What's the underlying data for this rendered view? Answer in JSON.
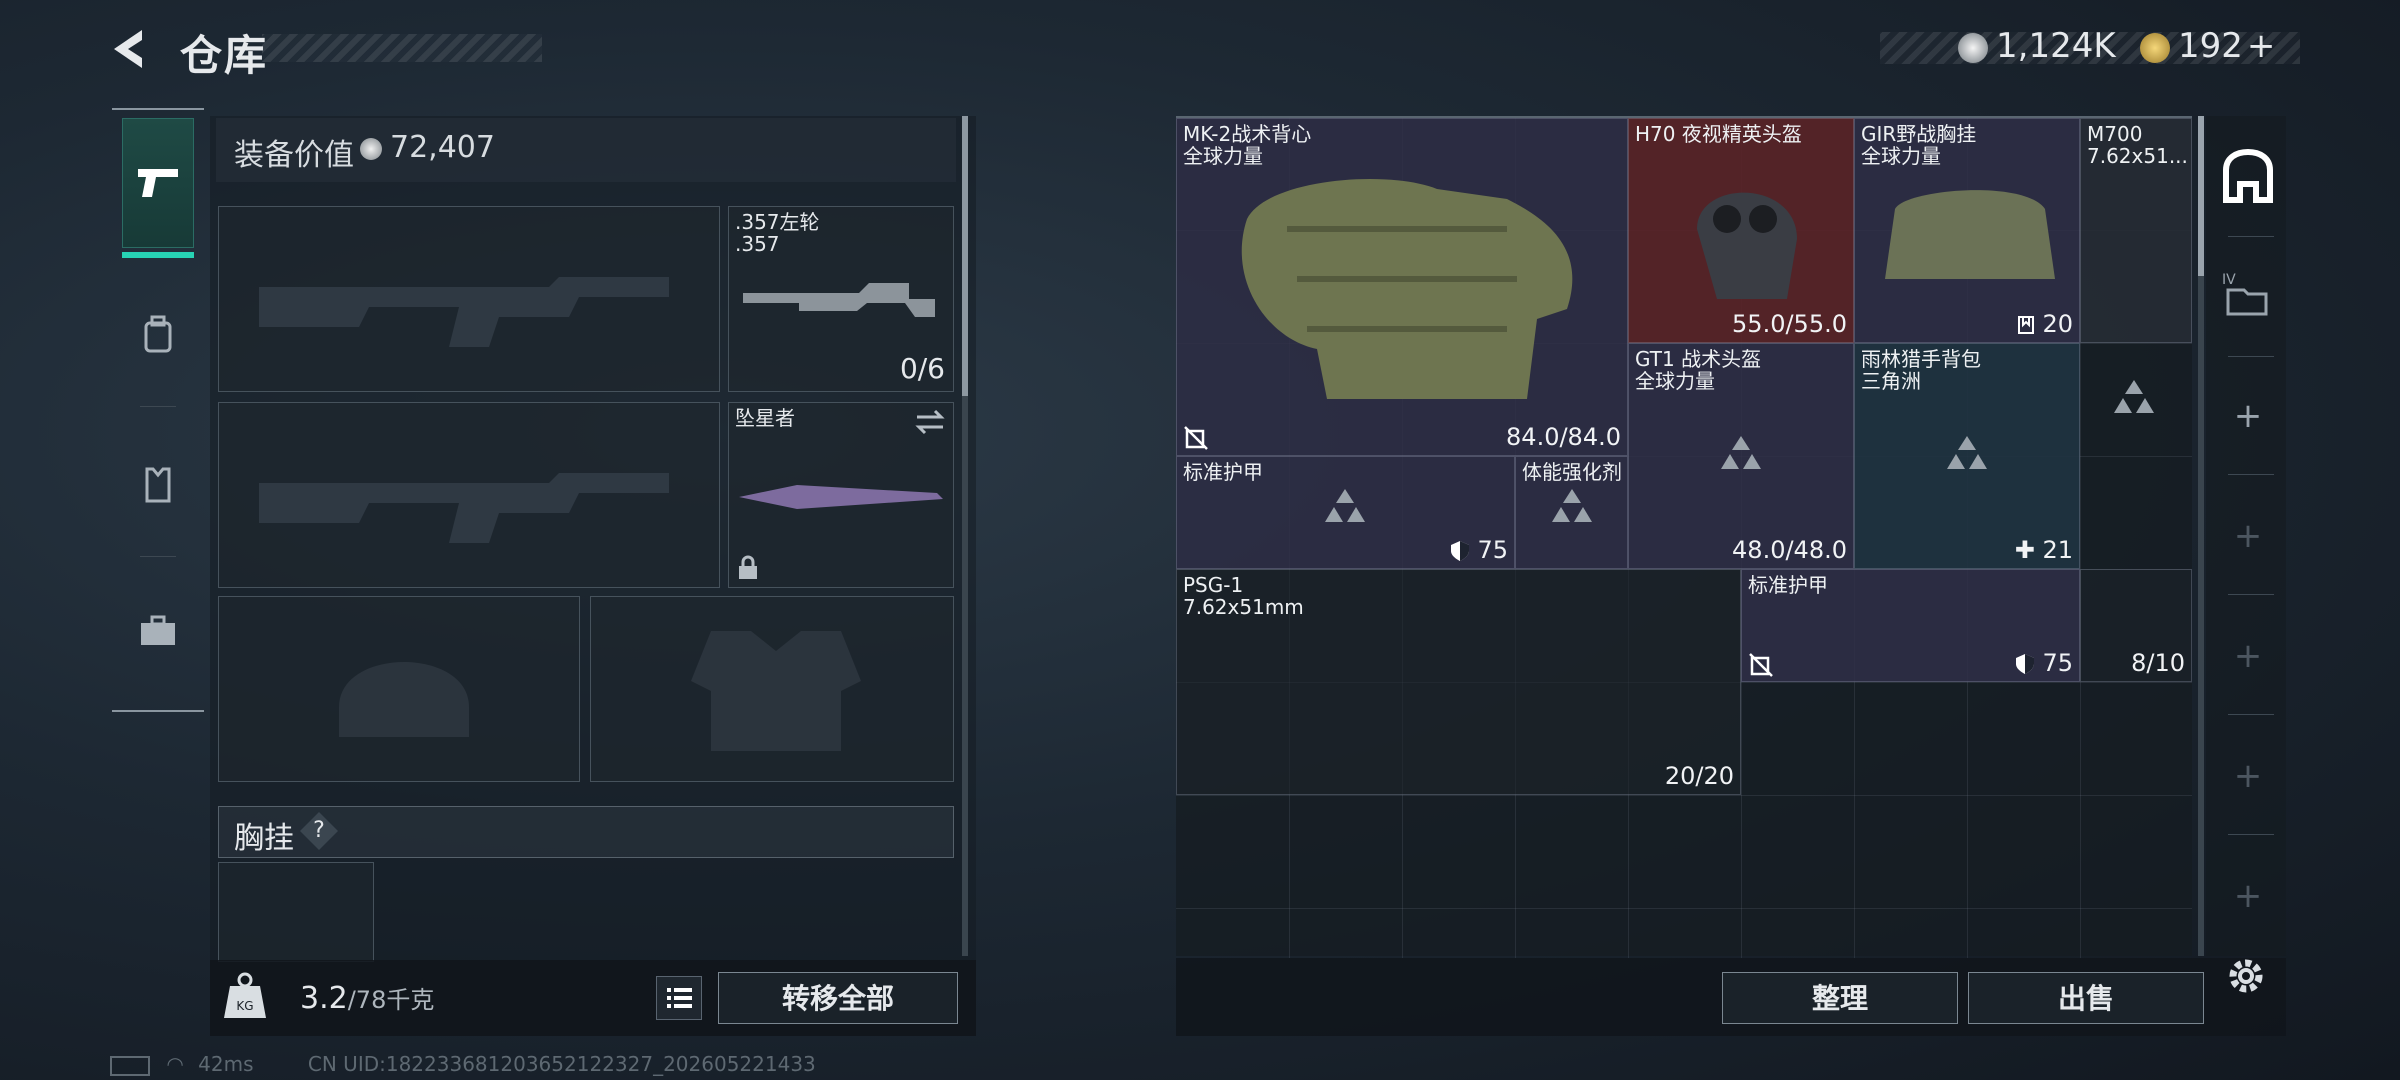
{
  "header": {
    "title": "仓库",
    "back_icon": "back-arrow-icon"
  },
  "currency": {
    "silver": "1,124K",
    "gold": "192",
    "gold_add": "+"
  },
  "left_rail": {
    "tabs": [
      {
        "name": "weapon",
        "icon": "pistol-icon",
        "active": true
      },
      {
        "name": "gear",
        "icon": "backpack-icon",
        "active": false
      },
      {
        "name": "vest",
        "icon": "vest-icon",
        "active": false
      },
      {
        "name": "case",
        "icon": "toolbox-icon",
        "active": false
      }
    ]
  },
  "equipment": {
    "value_label": "装备价值",
    "value": "72,407",
    "revolver_name": ".357左轮",
    "revolver_ammo": ".357",
    "revolver_count": "0/6",
    "melee_name": "坠星者",
    "chest_label": "胸挂",
    "help": "?"
  },
  "weight": {
    "current": "3.2",
    "max": "/78千克"
  },
  "buttons": {
    "transfer_all": "转移全部",
    "organize": "整理",
    "sell": "出售"
  },
  "stash": {
    "items": [
      {
        "id": "vest",
        "name": "MK-2战术背心",
        "sub": "全球力量",
        "value": "84.0/84.0",
        "color": "#2f2f48"
      },
      {
        "id": "helmet-nv",
        "name": "H70 夜视精英头盔",
        "sub": "",
        "value": "55.0/55.0",
        "color": "#5a2428"
      },
      {
        "id": "rig",
        "name": "GIR野战胸挂",
        "sub": "全球力量",
        "value": "20",
        "color": "#2f2f48"
      },
      {
        "id": "m700",
        "name": "M700",
        "sub": "7.62x51...",
        "value": "",
        "color": "#262c35"
      },
      {
        "id": "gt1",
        "name": "GT1 战术头盔",
        "sub": "全球力量",
        "value": "48.0/48.0",
        "color": "#2f2f48"
      },
      {
        "id": "backpack",
        "name": "雨林猎手背包",
        "sub": "三角洲",
        "value": "21",
        "color": "#1f3341"
      },
      {
        "id": "armor1",
        "name": "标准护甲",
        "sub": "",
        "value": "75",
        "color": "#2f2f48"
      },
      {
        "id": "stim",
        "name": "体能强化剂",
        "sub": "",
        "value": "",
        "color": "#2f2f48"
      },
      {
        "id": "psg1",
        "name": "PSG-1",
        "sub": "7.62x51mm",
        "value": "20/20",
        "color": "#1d232a"
      },
      {
        "id": "armor2",
        "name": "标准护甲",
        "sub": "",
        "value": "75",
        "color": "#2f2f48"
      },
      {
        "id": "ammo",
        "name": "",
        "sub": "",
        "value": "8/10",
        "color": "#1d232a"
      }
    ]
  },
  "footer": {
    "ping": "42ms",
    "uid": "CN UID:182233681203652122327_202605221433"
  },
  "colors": {
    "accent": "#27d3b4",
    "highlight_red": "#5a2428",
    "blue_item": "#1f3341"
  }
}
